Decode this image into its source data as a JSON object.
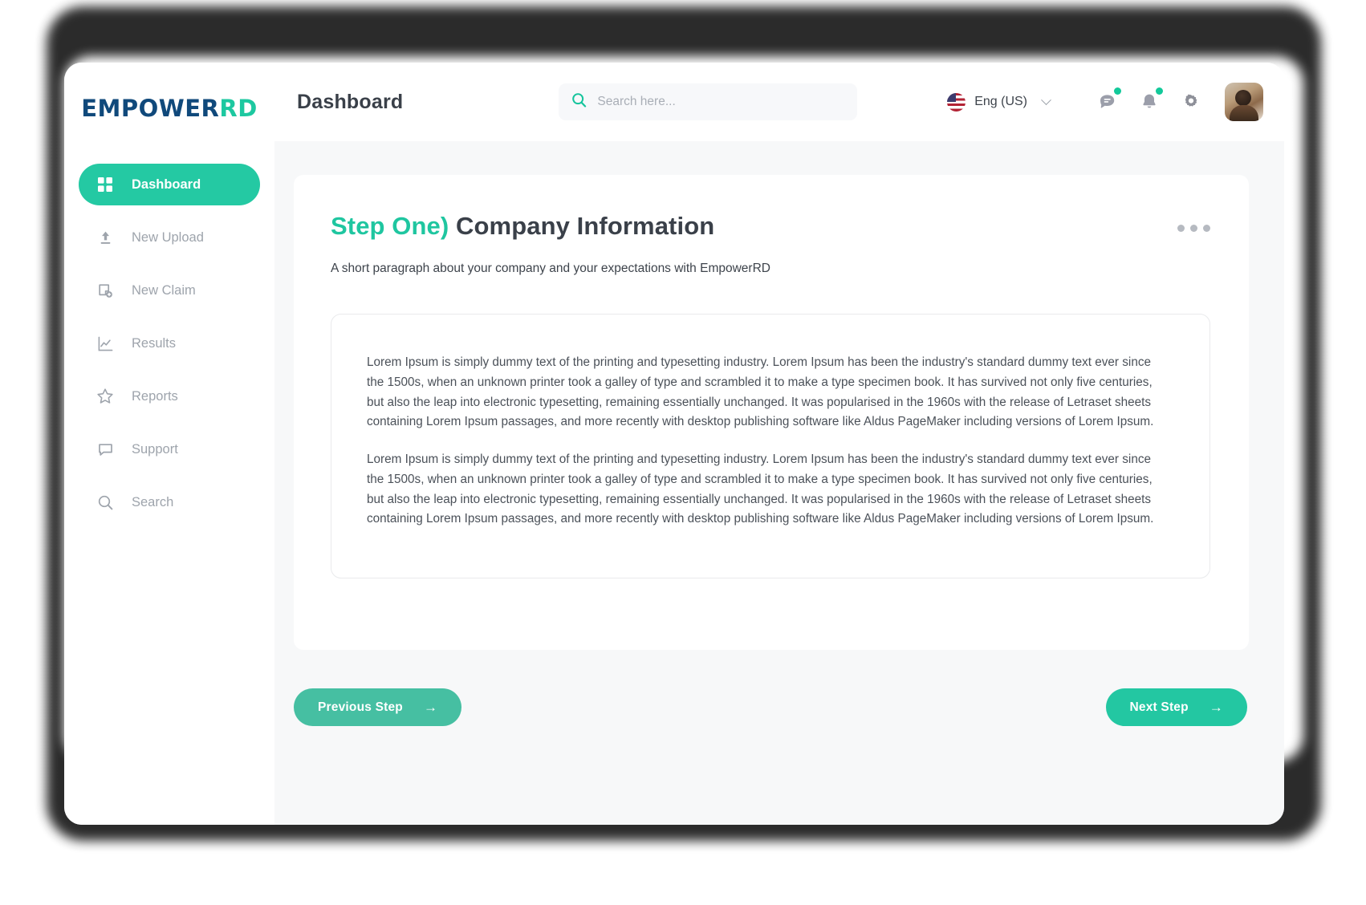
{
  "brand": {
    "name_primary": "EMPOWER",
    "name_accent": "RD"
  },
  "header": {
    "page_title": "Dashboard",
    "search": {
      "placeholder": "Search here...",
      "value": "",
      "icon": "search-icon"
    },
    "language": {
      "label": "Eng (US)",
      "flag": "us-flag-icon",
      "chevron": "chevron-down-icon"
    },
    "icons": [
      {
        "name": "messages-icon",
        "has_badge": true
      },
      {
        "name": "notifications-bell-icon",
        "has_badge": true
      },
      {
        "name": "settings-gear-icon",
        "has_badge": false
      }
    ],
    "avatar": "user-avatar"
  },
  "sidebar": {
    "items": [
      {
        "label": "Dashboard",
        "icon": "grid-icon",
        "active": true
      },
      {
        "label": "New Upload",
        "icon": "upload-icon",
        "active": false
      },
      {
        "label": "New Claim",
        "icon": "file-plus-icon",
        "active": false
      },
      {
        "label": "Results",
        "icon": "line-chart-icon",
        "active": false
      },
      {
        "label": "Reports",
        "icon": "star-icon",
        "active": false
      },
      {
        "label": "Support",
        "icon": "speech-bubble-icon",
        "active": false
      },
      {
        "label": "Search",
        "icon": "search-icon",
        "active": false
      }
    ]
  },
  "main": {
    "step_label": "Step One)",
    "step_heading": "Company Information",
    "overflow_menu": "more-options",
    "subtitle": "A short paragraph about your company and your expectations with EmpowerRD",
    "paragraphs": [
      "Lorem Ipsum is simply dummy text of the printing and typesetting industry. Lorem Ipsum has been the industry's standard dummy text ever since the 1500s, when an unknown printer took a galley of type and scrambled it to make a type specimen book. It has survived not only five centuries, but also the leap into electronic typesetting, remaining essentially unchanged. It was popularised in the 1960s with the release of Letraset sheets containing Lorem Ipsum passages, and more recently with desktop publishing software like Aldus PageMaker including versions of Lorem Ipsum.",
      "Lorem Ipsum is simply dummy text of the printing and typesetting industry. Lorem Ipsum has been the industry's standard dummy text ever since the 1500s, when an unknown printer took a galley of type and scrambled it to make a type specimen book. It has survived not only five centuries, but also the leap into electronic typesetting, remaining essentially unchanged. It was popularised in the 1960s with the release of Letraset sheets containing Lorem Ipsum passages, and more recently with desktop publishing software like Aldus PageMaker including versions of Lorem Ipsum."
    ],
    "buttons": {
      "previous": {
        "label": "Previous Step",
        "arrow": "→"
      },
      "next": {
        "label": "Next Step",
        "arrow": "→"
      }
    }
  },
  "colors": {
    "accent_teal": "#24c9a3",
    "brand_navy": "#10497b",
    "badge_green": "#12c99a",
    "text_dark": "#3a4049",
    "muted": "#9ea4ac",
    "canvas": "#f7f8f9"
  }
}
